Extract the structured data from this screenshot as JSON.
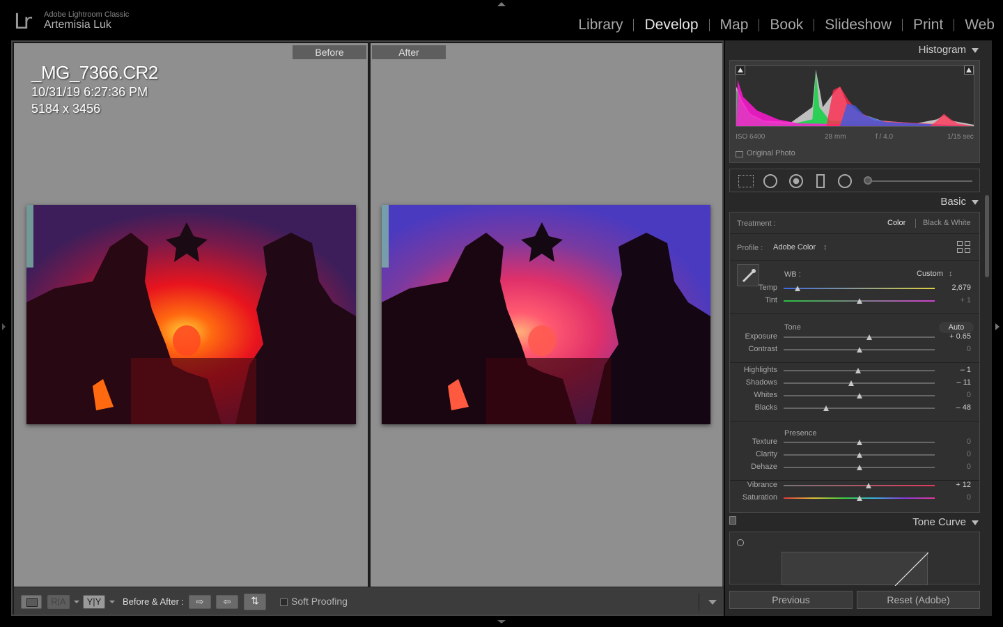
{
  "app": {
    "logo": "Lr",
    "name": "Adobe Lightroom Classic",
    "user": "Artemisia Luk"
  },
  "modules": [
    {
      "label": "Library",
      "active": false
    },
    {
      "label": "Develop",
      "active": true
    },
    {
      "label": "Map",
      "active": false
    },
    {
      "label": "Book",
      "active": false
    },
    {
      "label": "Slideshow",
      "active": false
    },
    {
      "label": "Print",
      "active": false
    },
    {
      "label": "Web",
      "active": false
    }
  ],
  "view": {
    "before_label": "Before",
    "after_label": "After",
    "file_name": "_MG_7366.CR2",
    "file_date": "10/31/19 6:27:36 PM",
    "file_dims": "5184 x 3456"
  },
  "toolbar": {
    "ra_label": "R|A",
    "yy_label": "Y|Y",
    "before_after_label": "Before & After :",
    "soft_proofing_label": "Soft Proofing",
    "soft_proofing_checked": false
  },
  "histogram": {
    "title": "Histogram",
    "iso": "ISO 6400",
    "focal": "28 mm",
    "aperture": "f / 4.0",
    "shutter": "1/15 sec",
    "original_photo_label": "Original Photo",
    "original_photo_checked": false
  },
  "basic": {
    "title": "Basic",
    "treatment_label": "Treatment :",
    "treatment_color": "Color",
    "treatment_bw": "Black & White",
    "profile_label": "Profile :",
    "profile_value": "Adobe Color",
    "wb_label": "WB :",
    "wb_value": "Custom",
    "tone_label": "Tone",
    "auto_label": "Auto",
    "presence_label": "Presence",
    "sliders": {
      "temp": {
        "label": "Temp",
        "value": "2,679",
        "pos": 0.09
      },
      "tint": {
        "label": "Tint",
        "value": "+ 1",
        "pos": 0.5
      },
      "exposure": {
        "label": "Exposure",
        "value": "+ 0.65",
        "pos": 0.565
      },
      "contrast": {
        "label": "Contrast",
        "value": "0",
        "pos": 0.5
      },
      "highlights": {
        "label": "Highlights",
        "value": "– 1",
        "pos": 0.495
      },
      "shadows": {
        "label": "Shadows",
        "value": "– 11",
        "pos": 0.445
      },
      "whites": {
        "label": "Whites",
        "value": "0",
        "pos": 0.5
      },
      "blacks": {
        "label": "Blacks",
        "value": "– 48",
        "pos": 0.28
      },
      "texture": {
        "label": "Texture",
        "value": "0",
        "pos": 0.5
      },
      "clarity": {
        "label": "Clarity",
        "value": "0",
        "pos": 0.5
      },
      "dehaze": {
        "label": "Dehaze",
        "value": "0",
        "pos": 0.5
      },
      "vibrance": {
        "label": "Vibrance",
        "value": "+ 12",
        "pos": 0.56
      },
      "saturation": {
        "label": "Saturation",
        "value": "0",
        "pos": 0.5
      }
    }
  },
  "tone_curve": {
    "title": "Tone Curve"
  },
  "buttons": {
    "previous": "Previous",
    "reset": "Reset (Adobe)"
  },
  "colors": {
    "panel_bg": "#282828",
    "view_bg": "#8f8f8f",
    "accent_red": "#ff2a2a",
    "accent_green": "#19c94a"
  }
}
